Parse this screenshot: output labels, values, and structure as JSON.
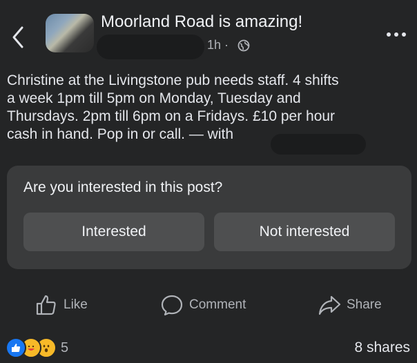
{
  "header": {
    "group_name": "Moorland Road is amazing!",
    "time": "1h ·",
    "icons": {
      "back": "chevron-left-icon",
      "more": "more-dots-icon",
      "privacy": "globe-icon"
    }
  },
  "post": {
    "text": "Christine at the Livingstone pub needs staff. 4 shifts\na week 1pm till 5pm on Monday, Tuesday and\nThursdays.  2pm till 6pm on a Fridays. £10 per hour\ncash in hand. Pop in or call. — with"
  },
  "interest_prompt": {
    "question": "Are you interested in this post?",
    "interested_label": "Interested",
    "not_interested_label": "Not interested"
  },
  "actions": {
    "like_label": "Like",
    "comment_label": "Comment",
    "share_label": "Share"
  },
  "footer": {
    "reaction_count": "5",
    "shares": "8 shares",
    "reaction_icons": [
      "like-reaction-icon",
      "care-reaction-icon",
      "wow-reaction-icon"
    ]
  },
  "colors": {
    "background": "#242526",
    "card": "#3a3b3c",
    "button": "#4e4f50",
    "like_blue": "#1877f2",
    "reaction_yellow": "#f7b928"
  }
}
